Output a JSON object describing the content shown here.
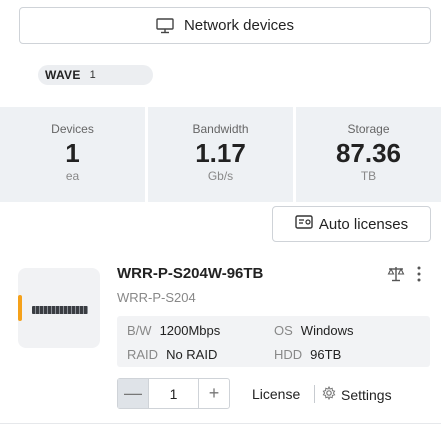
{
  "header": {
    "network_devices_label": "Network devices"
  },
  "group": {
    "name": "WAVE",
    "count": "1"
  },
  "stats": [
    {
      "label": "Devices",
      "value": "1",
      "unit": "ea"
    },
    {
      "label": "Bandwidth",
      "value": "1.17",
      "unit": "Gb/s"
    },
    {
      "label": "Storage",
      "value": "87.36",
      "unit": "TB"
    }
  ],
  "toolbar": {
    "auto_licenses_label": "Auto licenses"
  },
  "device": {
    "name": "WRR-P-S204W-96TB",
    "model": "WRR-P-S204",
    "specs": {
      "bw_label": "B/W",
      "bw_value": "1200Mbps",
      "os_label": "OS",
      "os_value": "Windows",
      "raid_label": "RAID",
      "raid_value": "No RAID",
      "hdd_label": "HDD",
      "hdd_value": "96TB"
    },
    "quantity": "1",
    "minus_symbol": "—",
    "plus_symbol": "+",
    "license_label": "License",
    "settings_label": "Settings",
    "accent_color": "#f5a11a"
  },
  "icons": {
    "network": "monitor-icon",
    "license": "license-card-icon",
    "compare": "scale-icon",
    "more": "more-vertical-icon",
    "settings": "gear-icon"
  }
}
